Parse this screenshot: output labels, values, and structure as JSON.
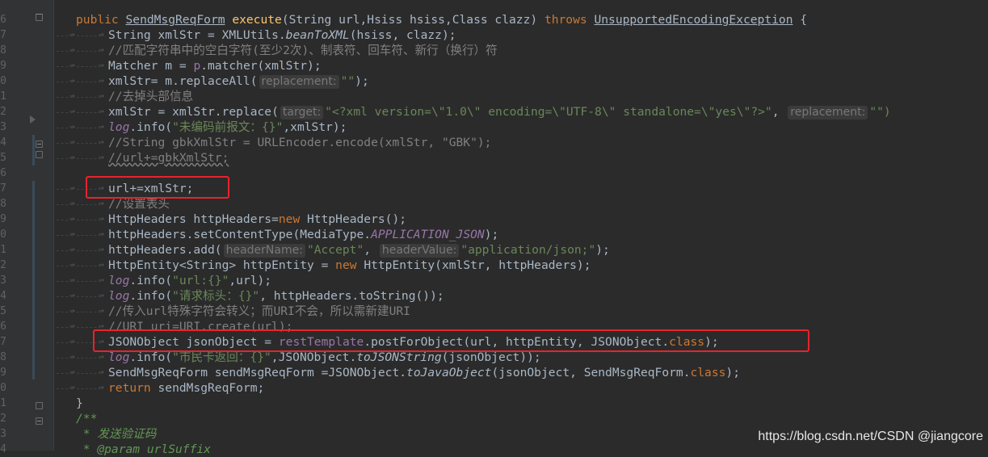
{
  "editor": {
    "line_numbers": [
      "6",
      "7",
      "8",
      "9",
      "0",
      "1",
      "2",
      "3",
      "4",
      "5",
      "6",
      "7",
      "8",
      "9",
      "0",
      "1",
      "2",
      "3",
      "4",
      "5",
      "6",
      "7",
      "8",
      "9",
      "0",
      "1",
      "2",
      "3",
      "4"
    ],
    "code": {
      "l1_kw": "public",
      "l1_name": "SendMsgReqForm",
      "l1_method": "execute",
      "l1_params": "(String url,Hsiss hsiss,Class clazz)",
      "l1_throws": "throws",
      "l1_exc": "UnsupportedEncodingException",
      "l1_brace": "{",
      "l2_a": "String xmlStr = XMLUtils.",
      "l2_m": "beanToXML",
      "l2_b": "(hsiss, clazz);",
      "l3": "//匹配字符串中的空白字符(至少2次)、制表符、回车符、新行（换行）符",
      "l4_a": "Matcher m = ",
      "l4_f": "p",
      "l4_b": ".matcher(xmlStr);",
      "l5_a": "xmlStr= m.replaceAll(",
      "l5_hint": "replacement:",
      "l5_s": "\"\"",
      "l5_b": ");",
      "l6": "//去掉头部信息",
      "l7_a": "xmlStr = xmlStr.replace(",
      "l7_hint1": "target:",
      "l7_s1": "\"<?xml version=\\\"1.0\\\" encoding=\\\"UTF-8\\\" standalone=\\\"yes\\\"?>\"",
      "l7_c": ",",
      "l7_hint2": "replacement:",
      "l7_s2": "\"\")",
      "l8_log": "log",
      "l8_a": ".info(",
      "l8_s": "\"未编码前报文：{}\"",
      "l8_b": ",xmlStr);",
      "l9": "//String gbkXmlStr = URLEncoder.encode(xmlStr, \"GBK\");",
      "l10": "//url+=gbkXmlStr;",
      "l12": "url+=xmlStr;",
      "l13": "//设置表头",
      "l14_a": "HttpHeaders httpHeaders=",
      "l14_kw": "new",
      "l14_b": " HttpHeaders();",
      "l15_a": "httpHeaders.setContentType(MediaType.",
      "l15_f": "APPLICATION_JSON",
      "l15_b": ");",
      "l16_a": "httpHeaders.add(",
      "l16_h1": "headerName:",
      "l16_s1": "\"Accept\"",
      "l16_c": ",",
      "l16_h2": "headerValue:",
      "l16_s2": "\"application/json;\"",
      "l16_b": ");",
      "l17_a": "HttpEntity<String> httpEntity = ",
      "l17_kw": "new",
      "l17_b": " HttpEntity(xmlStr, httpHeaders);",
      "l18_log": "log",
      "l18_a": ".info(",
      "l18_s": "\"url:{}\"",
      "l18_b": ",url);",
      "l19_log": "log",
      "l19_a": ".info(",
      "l19_s": "\"请求标头：{}\"",
      "l19_b": ", httpHeaders.toString());",
      "l20": "//传入url特殊字符会转义；而URI不会，所以需新建URI",
      "l21": "//URI uri=URI.create(url);",
      "l22_a": "JSONObject jsonObject = ",
      "l22_f": "restTemplate",
      "l22_b": ".postForObject(url, httpEntity, JSONObject.",
      "l22_kw": "class",
      "l22_c": ");",
      "l23_log": "log",
      "l23_a": ".info(",
      "l23_s": "\"市民卡返回：{}\"",
      "l23_b": ",JSONObject.",
      "l23_m": "toJSONString",
      "l23_c": "(jsonObject));",
      "l24_a": "SendMsgReqForm sendMsgReqForm =JSONObject.",
      "l24_m": "toJavaObject",
      "l24_b": "(jsonObject, SendMsgReqForm.",
      "l24_kw": "class",
      "l24_c": ");",
      "l25_kw": "return",
      "l25_b": " sendMsgReqForm;",
      "l26": "}",
      "l27": "/**",
      "l28": " * 发送验证码",
      "l29": " * @param urlSuffix"
    },
    "indent_arrow": "→",
    "colors": {
      "background": "#2b2b2b",
      "keyword": "#cc7832",
      "string": "#6a8759",
      "comment": "#808080",
      "field": "#9876aa",
      "method_decl": "#ffc66d",
      "highlight_box": "#e8232b"
    }
  },
  "watermark": "https://blog.csdn.net/CSDN @jiangcore"
}
